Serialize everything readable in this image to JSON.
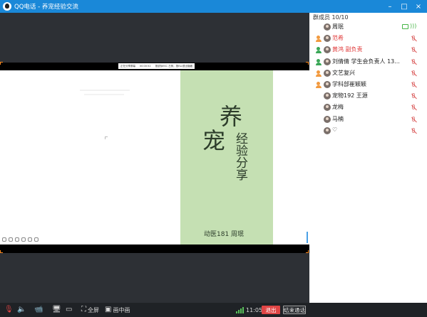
{
  "window": {
    "app_name": "QQ电话",
    "separator": " - ",
    "group_name": "养宠经验交流",
    "min_icon": "minimize-icon",
    "max_icon": "maximize-icon",
    "close_icon": "close-icon",
    "min_glyph": "–",
    "max_glyph": "□",
    "close_glyph": "×"
  },
  "share_bar": {
    "items": [
      "正在分享屏幕",
      "00:00:52",
      "按鼠标ESC 左侧，按Esc退出隐藏"
    ]
  },
  "slide": {
    "title_char_1": "养",
    "title_char_2": "宠",
    "subtitle": "经验分享",
    "presenter": "动医181 周珉",
    "accent_color": "#c5e0b3"
  },
  "members": {
    "header": "群成员 10/10",
    "list": [
      {
        "name": "周珉",
        "role": "none",
        "status": "speaking",
        "name_color": "normal"
      },
      {
        "name": "范希",
        "role": "admin",
        "status": "muted",
        "name_color": "red"
      },
      {
        "name": "黄鸿  副负责",
        "role": "owner",
        "status": "muted",
        "name_color": "red"
      },
      {
        "name": "刘倩倩 学生会负责人 13...",
        "role": "owner",
        "status": "muted",
        "name_color": "normal"
      },
      {
        "name": "文艺复兴",
        "role": "admin",
        "status": "muted",
        "name_color": "normal"
      },
      {
        "name": "学科部崔颖颖",
        "role": "admin",
        "status": "muted",
        "name_color": "normal"
      },
      {
        "name": "宠物192 王源",
        "role": "none",
        "status": "muted",
        "name_color": "normal"
      },
      {
        "name": "龙梅",
        "role": "none",
        "status": "muted",
        "name_color": "normal"
      },
      {
        "name": "马楠",
        "role": "none",
        "status": "muted",
        "name_color": "normal"
      },
      {
        "name": "♡",
        "role": "none",
        "status": "muted",
        "name_color": "normal"
      }
    ]
  },
  "toolbar": {
    "mic_glyph": "🎙",
    "speaker_glyph": "🔈",
    "camera_glyph": "📹",
    "screen_glyph": "🖥",
    "whiteboard_glyph": "▭",
    "fullscreen_glyph": "⛶",
    "fullscreen_label": "全屏",
    "pip_glyph": "▣",
    "pip_label": "画中画",
    "time": "11:05",
    "exit_label": "退出",
    "end_label": "结束通话"
  },
  "colors": {
    "titlebar": "#1a88d8",
    "exit_button": "#e04545",
    "muted": "#e05a5a",
    "speaking": "#45b545"
  }
}
